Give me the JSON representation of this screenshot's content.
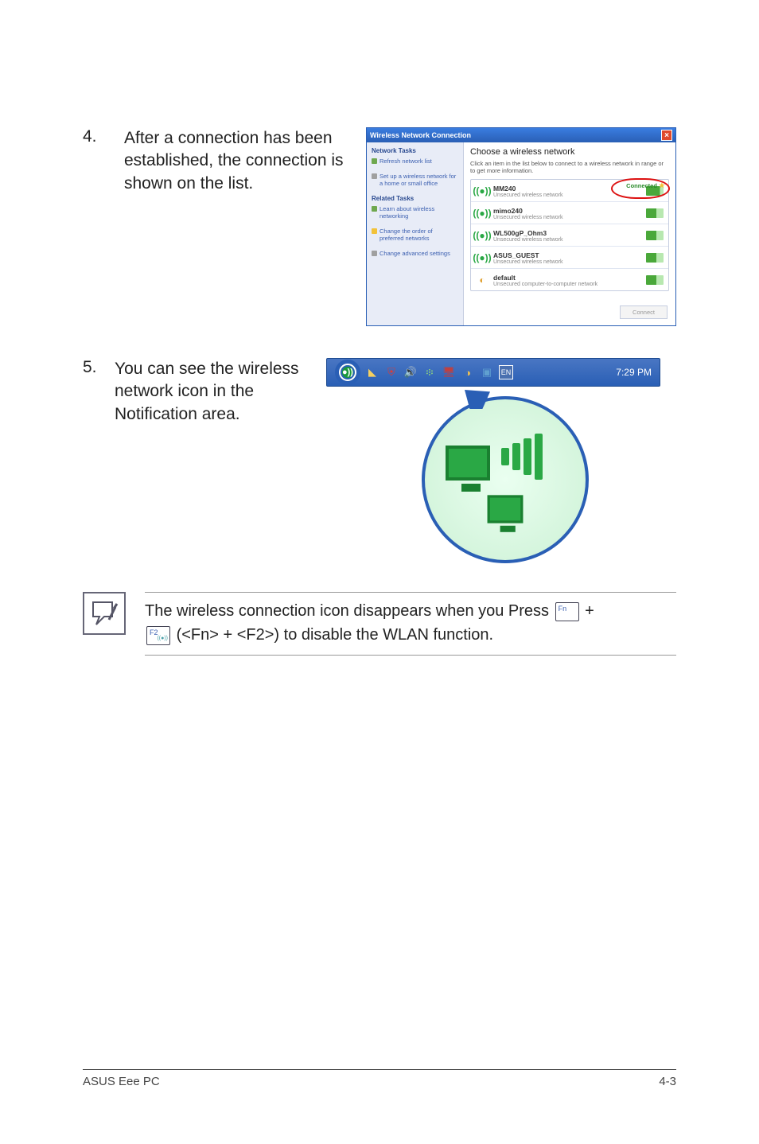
{
  "step4": {
    "num": "4.",
    "text": "After a connection has been established, the connection is shown on the list."
  },
  "step5": {
    "num": "5.",
    "text": "You can see the wireless network icon in the Notification area."
  },
  "note": {
    "line1_a": "The wireless connection icon disappears when you Press ",
    "line1_b": " + ",
    "line2": " (<Fn> + <F2>) to disable the WLAN function.",
    "key_fn": "Fn",
    "key_f2": "F2"
  },
  "wnc": {
    "title": "Wireless Network Connection",
    "choose": "Choose a wireless network",
    "hint": "Click an item in the list below to connect to a wireless network in range or to get more information.",
    "side": {
      "tasks_head": "Network Tasks",
      "refresh": "Refresh network list",
      "setup": "Set up a wireless network for a home or small office",
      "related_head": "Related Tasks",
      "learn": "Learn about wireless networking",
      "order": "Change the order of preferred networks",
      "adv": "Change advanced settings"
    },
    "connected_label": "Connected",
    "connect_btn": "Connect",
    "nets": [
      {
        "name": "MM240",
        "sub": "Unsecured wireless network"
      },
      {
        "name": "mimo240",
        "sub": "Unsecured wireless network"
      },
      {
        "name": "WL500gP_Ohm3",
        "sub": "Unsecured wireless network"
      },
      {
        "name": "ASUS_GUEST",
        "sub": "Unsecured wireless network"
      },
      {
        "name": "default",
        "sub": "Unsecured computer-to-computer network"
      }
    ]
  },
  "tray": {
    "time": "7:29 PM"
  },
  "footer": {
    "left": "ASUS Eee PC",
    "right": "4-3"
  }
}
